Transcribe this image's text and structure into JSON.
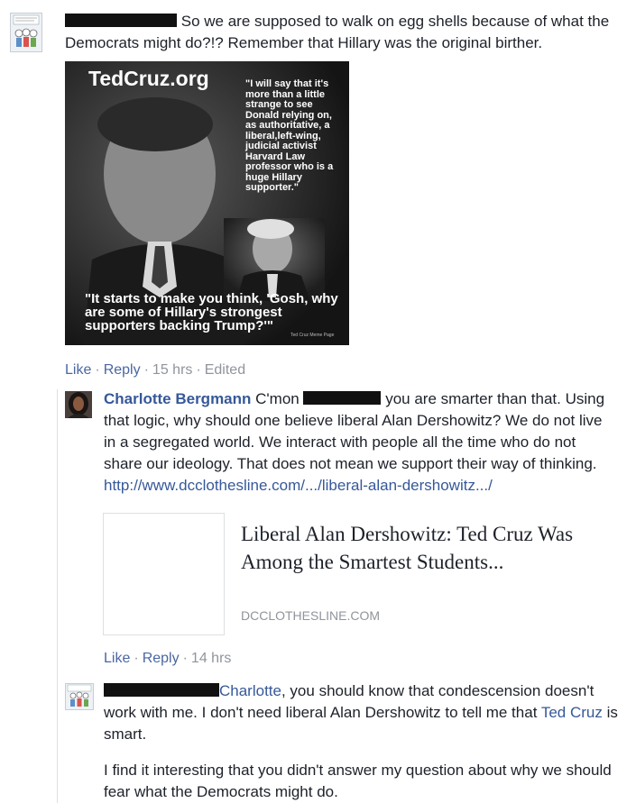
{
  "comment1": {
    "text": "So we are supposed to walk on egg shells because of what the Democrats might do?!? Remember that Hillary was the original birther.",
    "image": {
      "brand": "TedCruz.org",
      "quote_cruz": "\"I will say that it's more than a little strange to see Donald relying on, as authoritative, a liberal,left-wing, judicial activist Harvard Law professor who is a huge Hillary supporter.\"",
      "quote_bottom": "\"It starts to make you think, 'Gosh, why are some of Hillary's strongest supporters backing Trump?'\"",
      "tag": "Ted Cruz Meme Page"
    },
    "actions": {
      "like": "Like",
      "reply": "Reply",
      "time": "15 hrs",
      "edited": "Edited"
    }
  },
  "comment2": {
    "author": "Charlotte Bergmann",
    "text_a": "C'mon",
    "text_b": "you are smarter than that. Using that logic, why should one believe liberal Alan Dershowitz? We do not live in a segregated world. We interact with people all the time who do not share our ideology. That does not mean we support their way of thinking.",
    "url": "http://www.dcclothesline.com/.../liberal-alan-dershowitz.../",
    "link_preview": {
      "title": "Liberal Alan Dershowitz: Ted Cruz Was Among the Smartest Students...",
      "domain": "DCCLOTHESLINE.COM"
    },
    "actions": {
      "like": "Like",
      "reply": "Reply",
      "time": "14 hrs"
    }
  },
  "comment3": {
    "mention": "Charlotte",
    "text_a": ", you should know that condescension doesn't work with me. I don't need liberal Alan Dershowitz to tell me that",
    "mention2": "Ted Cruz",
    "text_b": "is smart.",
    "paragraph2": "I find it interesting that you didn't answer my question about why we should fear what the Democrats might do."
  },
  "colors": {
    "link": "#365899",
    "meta": "#90949c",
    "text": "#1d2129"
  }
}
